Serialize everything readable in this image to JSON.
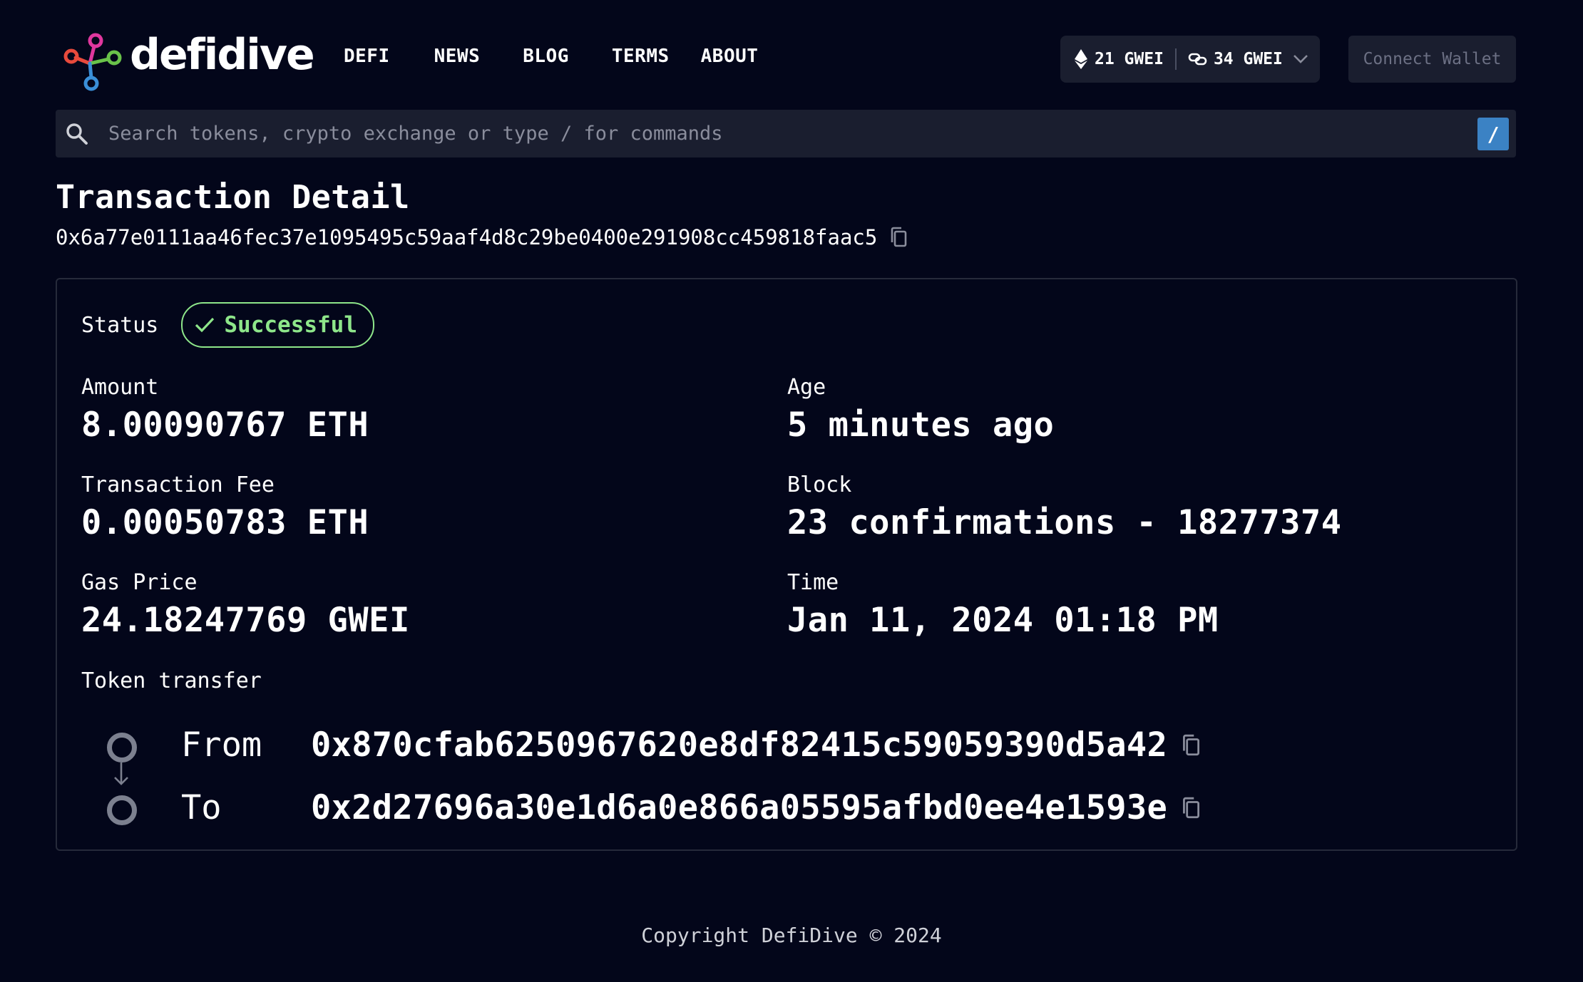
{
  "brand": {
    "name": "defidive",
    "icon": "molecule-logo"
  },
  "nav": {
    "items": [
      {
        "label": "DEFI"
      },
      {
        "label": "NEWS"
      },
      {
        "label": "BLOG"
      },
      {
        "label": "TERMS"
      },
      {
        "label": "ABOUT"
      }
    ]
  },
  "gas": {
    "eth_icon": "ethereum-icon",
    "eth_value": "21 GWEI",
    "chain_icon": "link-icon",
    "chain_value": "34 GWEI",
    "dropdown_icon": "chevron-down-icon"
  },
  "wallet": {
    "connect_label": "Connect Wallet"
  },
  "search": {
    "placeholder": "Search tokens, crypto exchange or type / for commands",
    "value": "",
    "shortcut": "/"
  },
  "transaction": {
    "title": "Transaction Detail",
    "hash": "0x6a77e0111aa46fec37e1095495c59aaf4d8c29be0400e291908cc459818faac5",
    "status_label": "Status",
    "status_value": "Successful",
    "status_color": "#8ee68a",
    "amount_label": "Amount",
    "amount_value": "8.00090767 ETH",
    "age_label": "Age",
    "age_value": "5 minutes ago",
    "fee_label": "Transaction Fee",
    "fee_value": "0.00050783 ETH",
    "block_label": "Block",
    "block_value": "23 confirmations - 18277374",
    "gas_price_label": "Gas Price",
    "gas_price_value": "24.18247769 GWEI",
    "time_label": "Time",
    "time_value": "Jan 11, 2024 01:18 PM",
    "token_transfer_label": "Token transfer",
    "from_label": "From",
    "from_address": "0x870cfab6250967620e8df82415c59059390d5a42",
    "to_label": "To",
    "to_address": "0x2d27696a30e1d6a0e866a05595afbd0ee4e1593e"
  },
  "footer": {
    "text": "Copyright DefiDive © 2024"
  },
  "colors": {
    "background": "#03061a",
    "panel": "#1a1e2f",
    "accent": "#3b82c4",
    "success": "#8ee68a"
  }
}
